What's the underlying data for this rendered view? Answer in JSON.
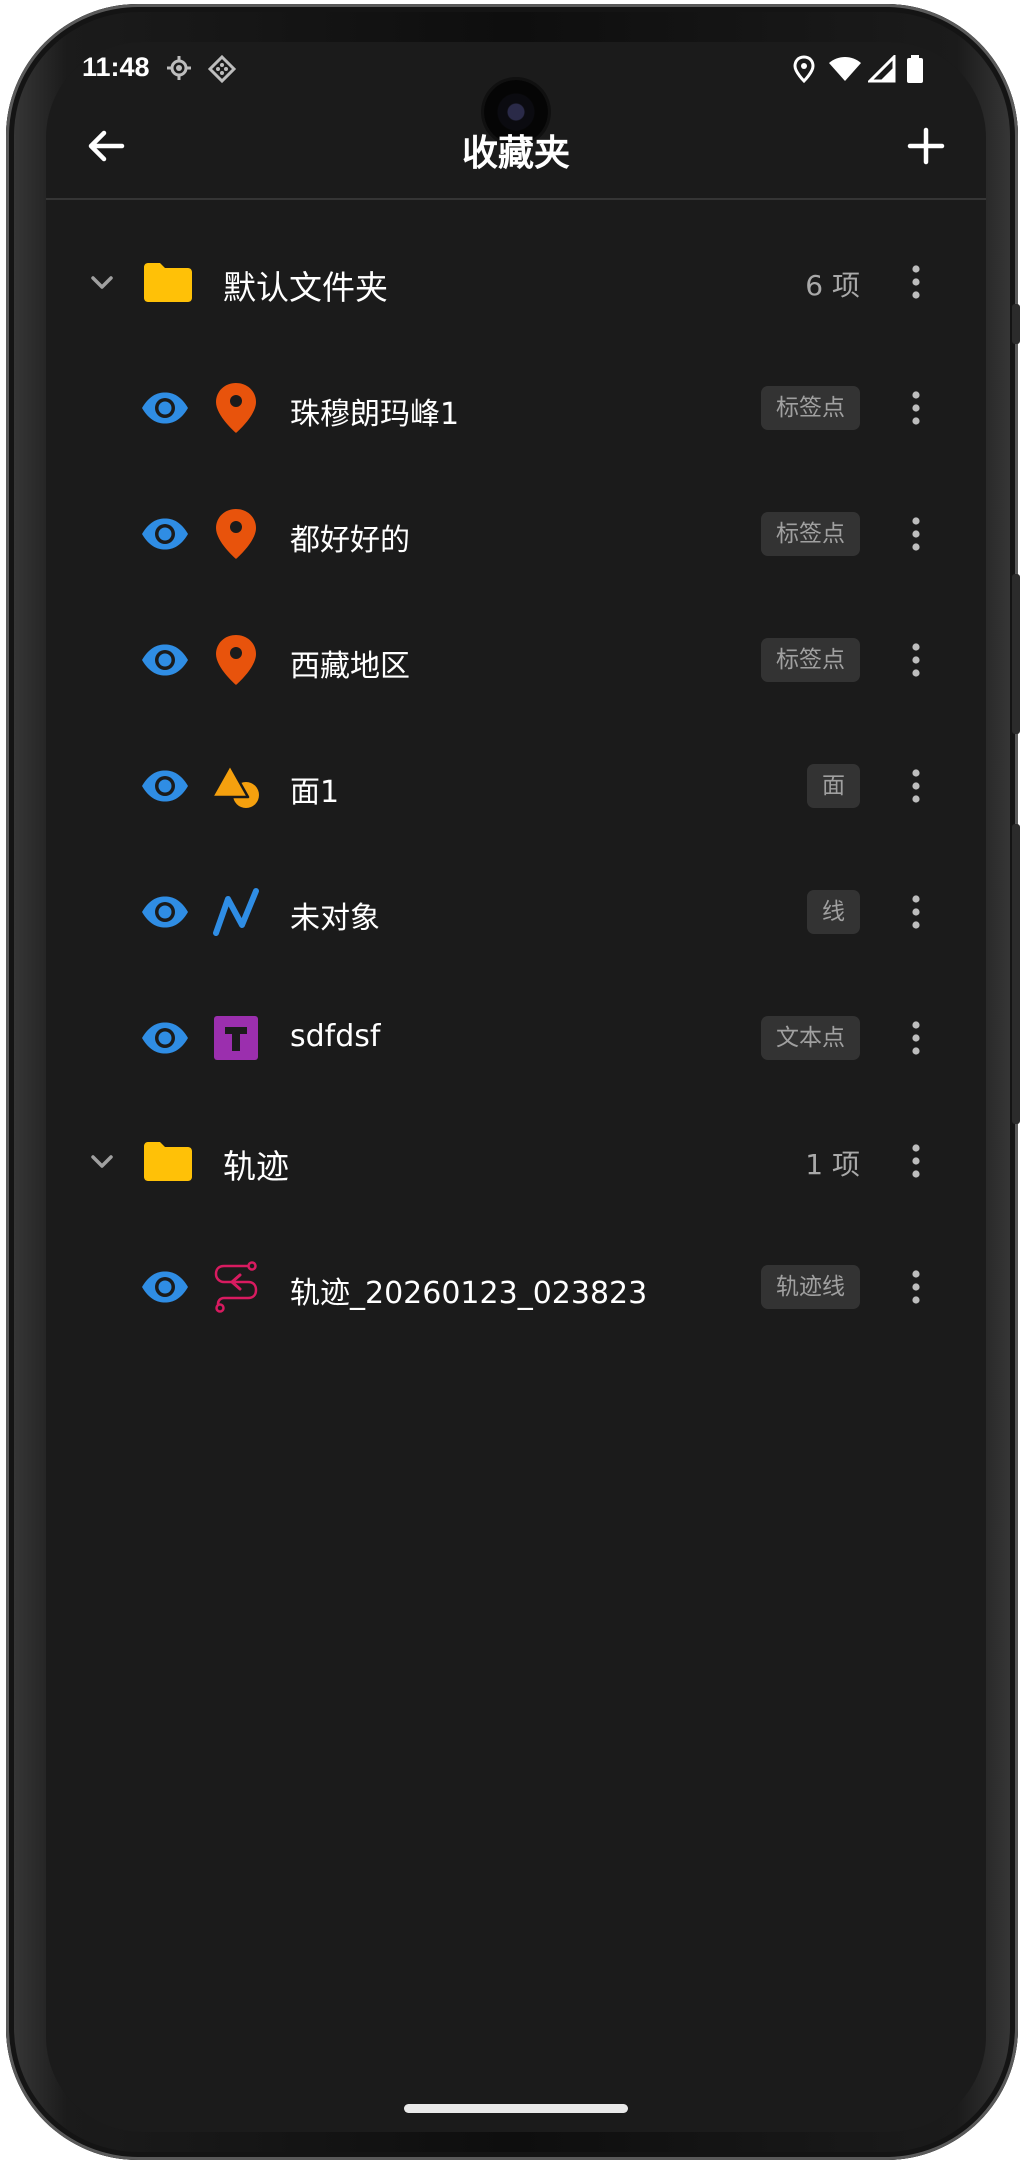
{
  "status_bar": {
    "time": "11:48"
  },
  "header": {
    "title": "收藏夹"
  },
  "folders": [
    {
      "name": "默认文件夹",
      "count": "6 项",
      "items": [
        {
          "name": "珠穆朗玛峰1",
          "type_label": "标签点",
          "icon": "location-pin-icon",
          "color": "#E8530C"
        },
        {
          "name": "都好好的",
          "type_label": "标签点",
          "icon": "location-pin-icon",
          "color": "#E8530C"
        },
        {
          "name": "西藏地区",
          "type_label": "标签点",
          "icon": "location-pin-icon",
          "color": "#E8530C"
        },
        {
          "name": "面1",
          "type_label": "面",
          "icon": "polygon-shape-icon",
          "color": "#F5A00E"
        },
        {
          "name": "未对象",
          "type_label": "线",
          "icon": "polyline-icon",
          "color": "#2F8DE4"
        },
        {
          "name": "sdfdsf",
          "type_label": "文本点",
          "icon": "text-point-icon",
          "color": "#9B2FAE"
        }
      ]
    },
    {
      "name": "轨迹",
      "count": "1 项",
      "items": [
        {
          "name": "轨迹_20260123_023823",
          "type_label": "轨迹线",
          "icon": "track-route-icon",
          "color": "#D81B60"
        }
      ]
    }
  ],
  "colors": {
    "background": "#1B1B1B",
    "folder": "#FFC107",
    "visible_eye": "#2F8DE4",
    "badge_bg": "#333333"
  }
}
